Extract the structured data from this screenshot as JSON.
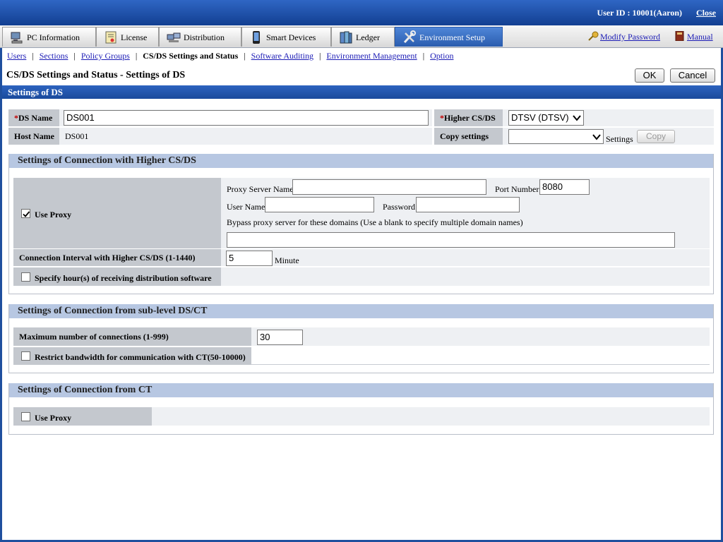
{
  "header": {
    "user_id": "User ID : 10001(Aaron)",
    "close": "Close"
  },
  "main_nav": {
    "tabs": [
      {
        "label": "PC Information",
        "icon": "pc-icon"
      },
      {
        "label": "License",
        "icon": "license-icon"
      },
      {
        "label": "Distribution",
        "icon": "distribution-icon"
      },
      {
        "label": "Smart Devices",
        "icon": "smart-device-icon"
      },
      {
        "label": "Ledger",
        "icon": "ledger-icon"
      },
      {
        "label": "Environment Setup",
        "icon": "tools-icon",
        "active": true
      }
    ],
    "modify_password": "Modify Password",
    "manual": "Manual"
  },
  "sub_nav": {
    "items": [
      "Users",
      "Sections",
      "Policy Groups",
      "CS/DS Settings and Status",
      "Software Auditing",
      "Environment Management",
      "Option"
    ],
    "current": "CS/DS Settings and Status"
  },
  "page": {
    "title": "CS/DS Settings and Status - Settings of DS",
    "ok": "OK",
    "cancel": "Cancel",
    "section_title": "Settings of DS"
  },
  "ds": {
    "required_mark": "*",
    "ds_name_label": "DS Name",
    "ds_name_value": "DS001",
    "host_name_label": "Host Name",
    "host_name_value": "DS001",
    "higher_label": "Higher CS/DS",
    "higher_value": "DTSV (DTSV)",
    "copy_settings_label": "Copy settings",
    "copy_settings_value": "",
    "settings_text": "Settings",
    "copy_button": "Copy"
  },
  "higher_conn": {
    "title": "Settings of Connection with Higher CS/DS",
    "use_proxy_label": "Use Proxy",
    "use_proxy_checked": true,
    "proxy_server_label": "Proxy Server Name",
    "proxy_server_value": "",
    "port_label": "Port Number",
    "port_value": "8080",
    "user_name_label": "User Name",
    "user_name_value": "",
    "password_label": "Password",
    "password_value": "",
    "bypass_label": "Bypass proxy server for these domains (Use a blank to specify multiple domain names)",
    "bypass_value": "",
    "interval_label": "Connection Interval with Higher CS/DS (1-1440)",
    "interval_value": "5",
    "interval_unit": "Minute",
    "receive_hours_label": "Specify hour(s) of receiving distribution software",
    "receive_hours_checked": false
  },
  "sub_conn": {
    "title": "Settings of Connection from sub-level DS/CT",
    "max_conn_label": "Maximum number of connections (1-999)",
    "max_conn_value": "30",
    "restrict_label": "Restrict bandwidth for communication with CT(50-10000)",
    "restrict_checked": false
  },
  "ct_conn": {
    "title": "Settings of Connection from CT",
    "use_proxy_label": "Use Proxy",
    "use_proxy_checked": false
  }
}
